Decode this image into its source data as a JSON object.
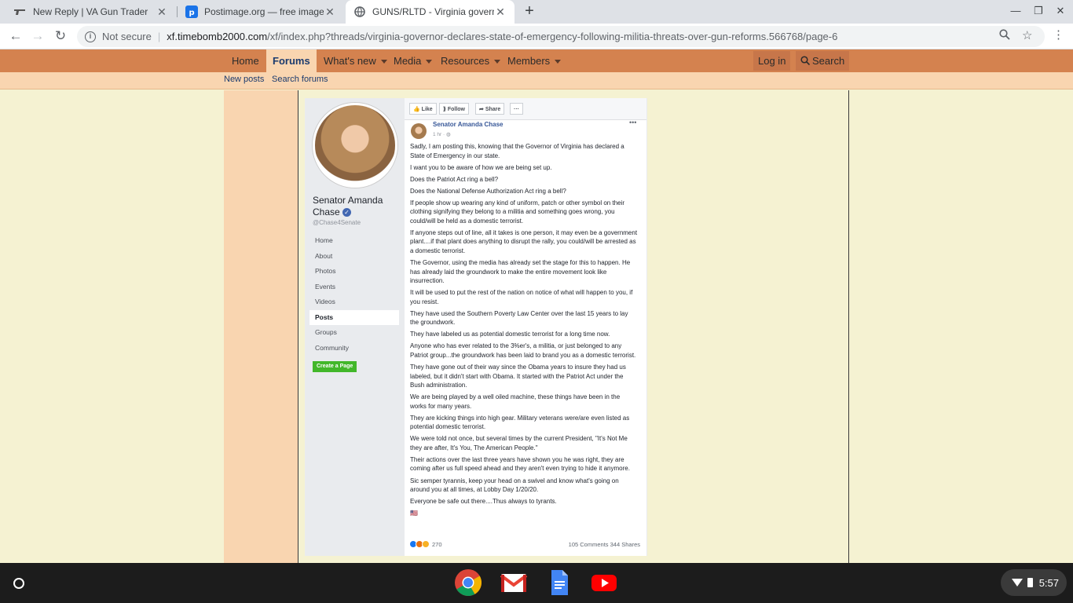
{
  "browser": {
    "tabs": [
      {
        "title": "New Reply | VA Gun Trader",
        "favicon": "gun-favicon"
      },
      {
        "title": "Postimage.org — free image hos",
        "favicon": "postimage-favicon"
      },
      {
        "title": "GUNS/RLTD - Virginia governor d",
        "favicon": "globe-favicon"
      }
    ],
    "new_tab_glyph": "+",
    "security_label": "Not secure",
    "url_host": "xf.timebomb2000.com",
    "url_path": "/xf/index.php?threads/virginia-governor-declares-state-of-emergency-following-militia-threats-over-gun-reforms.566768/page-6"
  },
  "forum": {
    "nav": [
      {
        "label": "Home",
        "dropdown": false
      },
      {
        "label": "Forums",
        "dropdown": false,
        "active": true
      },
      {
        "label": "What's new",
        "dropdown": true
      },
      {
        "label": "Media",
        "dropdown": true
      },
      {
        "label": "Resources",
        "dropdown": true
      },
      {
        "label": "Members",
        "dropdown": true
      }
    ],
    "login_label": "Log in",
    "search_label": "Search",
    "subnav": [
      "New posts",
      "Search forums"
    ]
  },
  "fb_post": {
    "page_name": "Senator Amanda Chase",
    "handle": "@Chase4Senate",
    "menu": [
      "Home",
      "About",
      "Photos",
      "Events",
      "Videos",
      "Posts",
      "Groups",
      "Community"
    ],
    "selected_menu": "Posts",
    "create_page_label": "Create a Page",
    "actions": [
      "Like",
      "Follow",
      "Share",
      "···"
    ],
    "author": "Senator Amanda Chase",
    "time": "1 hr · ",
    "more_glyph": "•••",
    "paragraphs": [
      "Sadly, I am posting this, knowing that the Governor of Virginia has declared a State of Emergency in our state.",
      "I want you to be aware of how we are being set up.",
      "Does the Patriot Act ring a bell?",
      "Does the National Defense Authorization Act ring a bell?",
      "If people show up wearing any kind of uniform, patch or other symbol on their clothing signifying they belong to a militia and something goes wrong, you could/will be held as a domestic terrorist.",
      "If anyone steps out of line, all it takes is one person, it may even be a government plant....if that plant does anything to disrupt the rally, you could/will be arrested as a domestic terrorist.",
      "The Governor, using the media has already set the stage for this to happen. He has already laid the groundwork to make the entire movement look like insurrection.",
      "It will be used to put the rest of the nation on notice of what will happen to you, if you resist.",
      "They have used the Southern Poverty Law Center over the last 15 years to lay the groundwork.",
      "They have labeled us as potential domestic terrorist for a long time now.",
      "Anyone who has ever related to the 3%er's, a militia, or just belonged to any Patriot group...the groundwork has been laid to brand you as a domestic terrorist.",
      "They have gone out of their way since the Obama years to insure they had us labeled, but it didn't start with Obama. It started with the Patriot Act under the Bush administration.",
      "We are being played by a well oiled machine, these things have been in the works for many years.",
      "They are kicking things into high gear. Military veterans were/are even listed as potential domestic terrorist.",
      "We were told not once, but several times by the current President, \"It's Not Me they are after, It's You, The American People.\"",
      "Their actions over the last three years have shown you he was right, they are coming after us full speed ahead and they aren't even trying to hide it anymore.",
      "Sic semper tyrannis, keep your head on a swivel and know what's going on around you at all times, at Lobby Day 1/20/20.",
      "Everyone be safe out there....Thus always to tyrants.",
      "🇺🇸"
    ],
    "reaction_count": "270",
    "comments": "105 Comments",
    "shares": "344 Shares"
  },
  "shelf": {
    "apps": [
      "chrome-icon",
      "gmail-icon",
      "docs-icon",
      "youtube-icon"
    ],
    "time": "5:57"
  },
  "colors": {
    "forum_nav": "#d4824f",
    "forum_subnav": "#f9d5b0",
    "page_bg": "#f5f2d2",
    "fb_link": "#385898"
  }
}
